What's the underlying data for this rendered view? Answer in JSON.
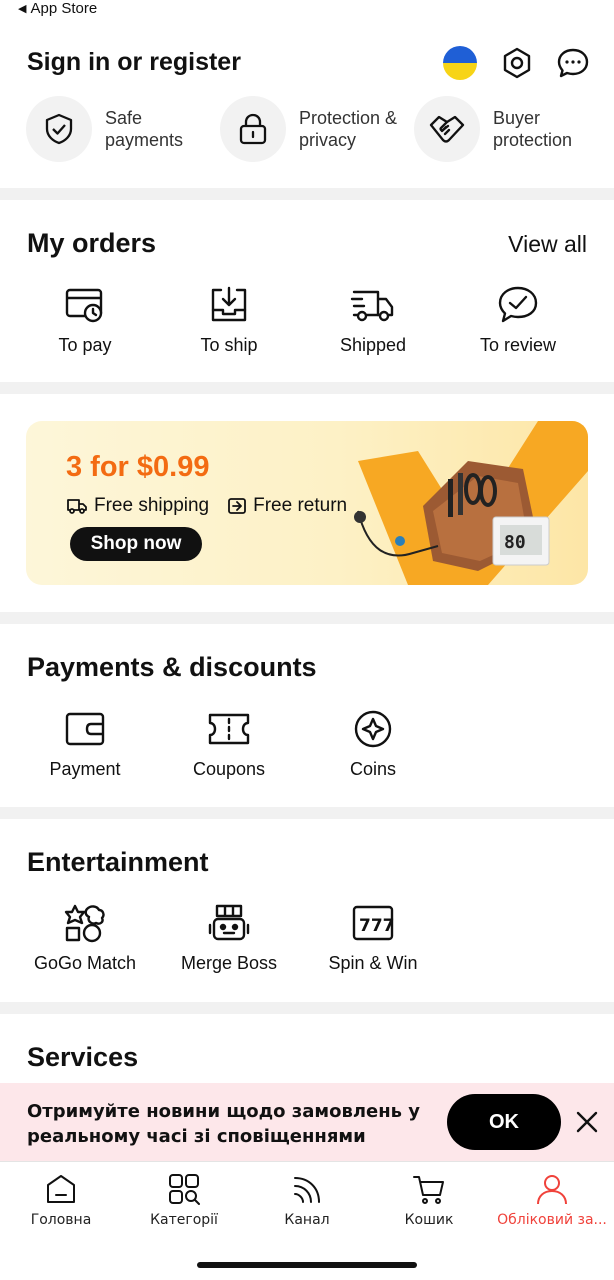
{
  "status_bar": {
    "back_label": "App Store"
  },
  "header": {
    "title": "Sign in or register",
    "assurances": [
      {
        "label": "Safe payments",
        "icon": "shield-check-icon"
      },
      {
        "label": "Protection & privacy",
        "icon": "lock-icon"
      },
      {
        "label": "Buyer protection",
        "icon": "handshake-icon"
      }
    ]
  },
  "orders": {
    "title": "My orders",
    "view_all": "View all",
    "items": [
      {
        "label": "To pay",
        "icon": "wallet-clock-icon"
      },
      {
        "label": "To ship",
        "icon": "box-download-icon"
      },
      {
        "label": "Shipped",
        "icon": "truck-icon"
      },
      {
        "label": "To review",
        "icon": "chat-check-icon"
      }
    ]
  },
  "banner": {
    "promo": "3 for $0.99",
    "perk_shipping": "Free shipping",
    "perk_return": "Free return",
    "button": "Shop now"
  },
  "payments": {
    "title": "Payments & discounts",
    "items": [
      {
        "label": "Payment",
        "icon": "wallet-icon"
      },
      {
        "label": "Coupons",
        "icon": "ticket-icon"
      },
      {
        "label": "Coins",
        "icon": "coin-icon"
      }
    ]
  },
  "entertainment": {
    "title": "Entertainment",
    "items": [
      {
        "label": "GoGo Match",
        "icon": "shapes-icon"
      },
      {
        "label": "Merge Boss",
        "icon": "robot-icon"
      },
      {
        "label": "Spin & Win",
        "icon": "slot-777-icon"
      }
    ]
  },
  "services": {
    "title": "Services"
  },
  "notification": {
    "message": "Отримуйте новини щодо замовлень у реальному часі зі сповіщеннями",
    "ok": "OK"
  },
  "tabbar": {
    "tabs": [
      {
        "label": "Головна",
        "icon": "home-icon"
      },
      {
        "label": "Категорії",
        "icon": "categories-icon"
      },
      {
        "label": "Канал",
        "icon": "feed-icon"
      },
      {
        "label": "Кошик",
        "icon": "cart-icon"
      },
      {
        "label": "Обліковий за...",
        "icon": "account-icon"
      }
    ],
    "active_color": "#f0423b"
  }
}
